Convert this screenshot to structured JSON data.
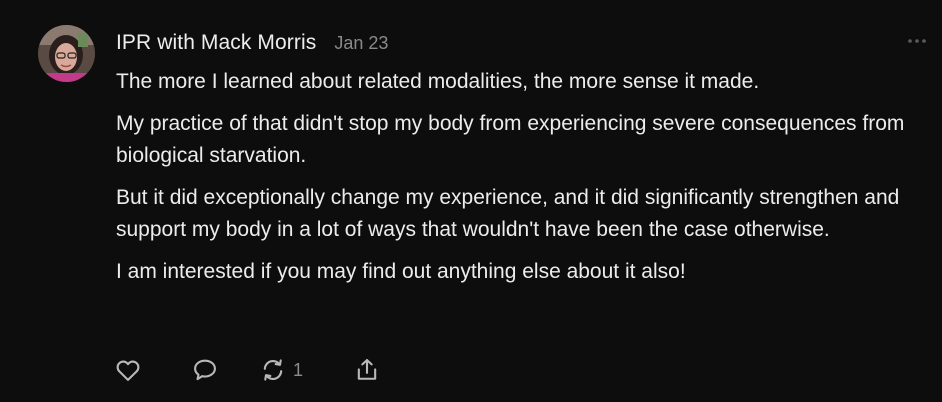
{
  "comment": {
    "author": "IPR with Mack Morris",
    "date": "Jan 23",
    "paragraphs": [
      "The more I learned about related modalities, the more sense it made.",
      "My practice of that didn't stop my body from experiencing severe consequences from biological starvation.",
      "But it did exceptionally change my experience, and it did significantly strengthen and support my body in a lot of ways that wouldn't have been the case otherwise.",
      "I am interested if you may find out anything else about it also!"
    ]
  },
  "actions": {
    "like_icon": "heart-icon",
    "reply_icon": "comment-bubble-icon",
    "restack_icon": "restack-arrows-icon",
    "restack_count": "1",
    "share_icon": "share-upload-icon",
    "more_icon": "ellipsis-icon"
  },
  "colors": {
    "background": "#0d0d0d",
    "text": "#ececec",
    "muted": "#8a8a8a",
    "icon": "#b8b8b8"
  }
}
